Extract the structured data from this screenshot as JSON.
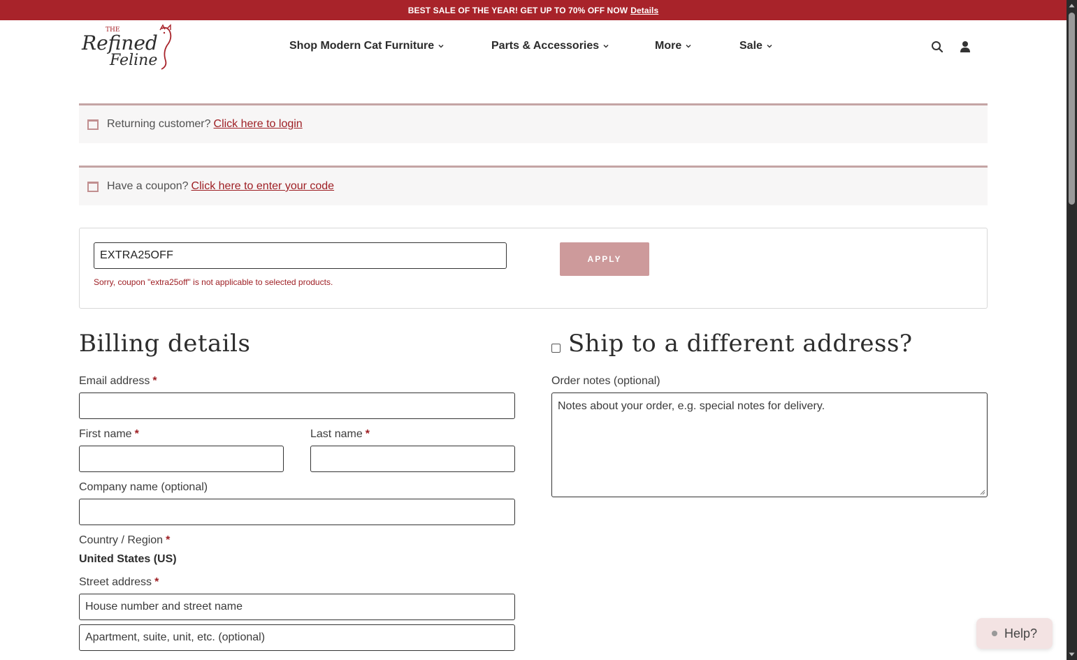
{
  "promo": {
    "text": "BEST SALE OF THE YEAR! GET UP TO 70% OFF NOW",
    "link": "Details"
  },
  "header": {
    "logo": {
      "line1": "THE",
      "line2": "Refined",
      "line3": "Feline"
    },
    "nav": [
      {
        "label": "Shop Modern Cat Furniture"
      },
      {
        "label": "Parts & Accessories"
      },
      {
        "label": "More"
      },
      {
        "label": "Sale"
      }
    ],
    "icons": [
      "search-icon",
      "account-icon"
    ]
  },
  "notices": {
    "login": {
      "text": "Returning customer?",
      "link": "Click here to login"
    },
    "coupon": {
      "text": "Have a coupon?",
      "link": "Click here to enter your code"
    }
  },
  "coupon_form": {
    "value": "EXTRA25OFF",
    "error": "Sorry, coupon \"extra25off\" is not applicable to selected products.",
    "apply_label": "APPLY"
  },
  "billing": {
    "title": "Billing details",
    "email_label": "Email address",
    "first_name_label": "First name",
    "last_name_label": "Last name",
    "company_label": "Company name (optional)",
    "country_label": "Country / Region",
    "country_value": "United States (US)",
    "street_label": "Street address",
    "street_placeholder": "House number and street name",
    "street2_placeholder": "Apartment, suite, unit, etc. (optional)",
    "required_mark": "*"
  },
  "shipping": {
    "title": "Ship to a different address?",
    "notes_label": "Order notes (optional)",
    "notes_placeholder": "Notes about your order, e.g. special notes for delivery."
  },
  "help": {
    "label": "Help?"
  },
  "colors": {
    "brand": "#a8232a",
    "accent": "#9e1f24",
    "button": "#cd9a9b",
    "notice_bg": "#f7f6f6"
  }
}
